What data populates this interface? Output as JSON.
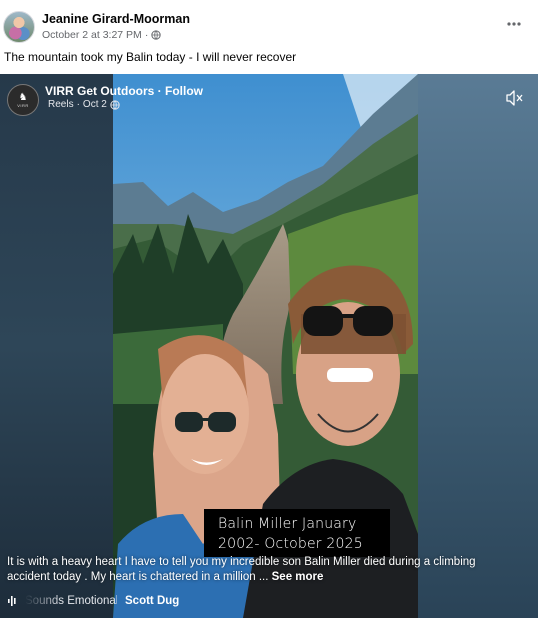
{
  "post": {
    "author": "Jeanine Girard-Moorman",
    "date": "October 2 at 3:27 PM",
    "separator": "·",
    "caption": "The mountain took my Balin today - I will never recover",
    "privacy_icon": "globe-icon",
    "more_icon": "more-horizontal-icon"
  },
  "reel": {
    "page_name": "VIRR Get Outdoors",
    "follow_label": "Follow",
    "title_separator": " · ",
    "type_label": "Reels",
    "date": "Oct 2",
    "avatar_text": "VIRR",
    "mute_icon": "volume-muted-icon",
    "name_card": {
      "line1": "Balin Miller January",
      "line2": "2002- October 2025"
    },
    "description": "It is with a heavy heart I have to tell you my incredible son Balin Miller died during a climbing accident today . My heart is chattered in a million ...",
    "see_more": "See more",
    "audio": {
      "track": "Sounds Emotional",
      "artist": "Scott Dug",
      "icon": "audio-waveform-icon"
    }
  },
  "colors": {
    "text_primary": "#050505",
    "text_secondary": "#65676b",
    "video_bg": "#2e4659"
  }
}
